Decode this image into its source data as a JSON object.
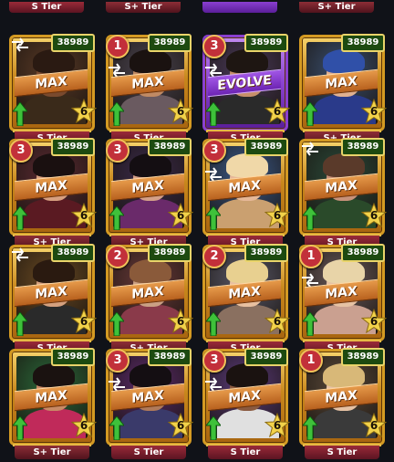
{
  "top_row_tiers": [
    "S Tier",
    "S+ Tier",
    "",
    "S+ Tier"
  ],
  "cards": [
    {
      "score": "38989",
      "level": "",
      "swap": true,
      "badge": "MAX",
      "stars": "6",
      "tier": "S Tier",
      "frame": "gold",
      "skin": "#7a4a2e",
      "hair": "#2a1a12",
      "outfit": "#3a2a1a",
      "bg": "#5a3a26"
    },
    {
      "score": "38989",
      "level": "1",
      "swap": true,
      "badge": "MAX",
      "stars": "6",
      "tier": "S Tier",
      "frame": "gold",
      "skin": "#c08a64",
      "hair": "#1a1210",
      "outfit": "#6a5a60",
      "bg": "#4a4450"
    },
    {
      "score": "38989",
      "level": "3",
      "swap": true,
      "badge": "EVOLVE",
      "stars": "6",
      "tier": "S Tier",
      "frame": "purple",
      "skin": "#c6906a",
      "hair": "#1e1612",
      "outfit": "#2a2a2a",
      "bg": "#4a3a5a"
    },
    {
      "score": "38989",
      "level": "",
      "swap": false,
      "badge": "MAX",
      "stars": "6",
      "tier": "S+ Tier",
      "frame": "gold",
      "skin": "#e0b090",
      "hair": "#3050a8",
      "outfit": "#2a3a8a",
      "bg": "#3a5070"
    },
    {
      "score": "38989",
      "level": "3",
      "swap": false,
      "badge": "MAX",
      "stars": "6",
      "tier": "S+ Tier",
      "frame": "gold",
      "skin": "#d8a080",
      "hair": "#1a1010",
      "outfit": "#5a1a22",
      "bg": "#5a2a32"
    },
    {
      "score": "38989",
      "level": "3",
      "swap": false,
      "badge": "MAX",
      "stars": "6",
      "tier": "S+ Tier",
      "frame": "gold",
      "skin": "#d4a088",
      "hair": "#140e12",
      "outfit": "#6a2a6a",
      "bg": "#3a2a4a"
    },
    {
      "score": "38989",
      "level": "3",
      "swap": true,
      "badge": "MAX",
      "stars": "6",
      "tier": "S Tier",
      "frame": "gold",
      "skin": "#e6b898",
      "hair": "#f0d8a8",
      "outfit": "#caa070",
      "bg": "#3a5a8a"
    },
    {
      "score": "38989",
      "level": "",
      "swap": true,
      "badge": "MAX",
      "stars": "6",
      "tier": "S Tier",
      "frame": "gold",
      "skin": "#c8927a",
      "hair": "#5a3a2a",
      "outfit": "#2a4a2a",
      "bg": "#2a4a3a"
    },
    {
      "score": "38989",
      "level": "",
      "swap": true,
      "badge": "MAX",
      "stars": "6",
      "tier": "S Tier",
      "frame": "gold",
      "skin": "#d4a07e",
      "hair": "#2a1a10",
      "outfit": "#2a2a2a",
      "bg": "#6a4a22"
    },
    {
      "score": "38989",
      "level": "2",
      "swap": false,
      "badge": "MAX",
      "stars": "6",
      "tier": "S+ Tier",
      "frame": "gold",
      "skin": "#caa084",
      "hair": "#8a5a3a",
      "outfit": "#8a3a4a",
      "bg": "#6a3a3a"
    },
    {
      "score": "38989",
      "level": "2",
      "swap": false,
      "badge": "MAX",
      "stars": "6",
      "tier": "S Tier",
      "frame": "gold",
      "skin": "#e8c0a0",
      "hair": "#e8d090",
      "outfit": "#8a7060",
      "bg": "#5a5a6a"
    },
    {
      "score": "38989",
      "level": "1",
      "swap": true,
      "badge": "MAX",
      "stars": "6",
      "tier": "S Tier",
      "frame": "gold",
      "skin": "#e6c2a4",
      "hair": "#e8d4a8",
      "outfit": "#caa090",
      "bg": "#6a5a5a"
    },
    {
      "score": "38989",
      "level": "",
      "swap": false,
      "badge": "MAX",
      "stars": "6",
      "tier": "S+ Tier",
      "frame": "gold",
      "skin": "#c88a66",
      "hair": "#1a1210",
      "outfit": "#c02a5a",
      "bg": "#2a6a3a"
    },
    {
      "score": "38989",
      "level": "3",
      "swap": true,
      "badge": "MAX",
      "stars": "6",
      "tier": "S Tier",
      "frame": "gold",
      "skin": "#b07a5a",
      "hair": "#140e12",
      "outfit": "#3a3a6a",
      "bg": "#5a2a6a"
    },
    {
      "score": "38989",
      "level": "3",
      "swap": true,
      "badge": "MAX",
      "stars": "6",
      "tier": "S Tier",
      "frame": "gold",
      "skin": "#8a5a40",
      "hair": "#1a1210",
      "outfit": "#e0e0e0",
      "bg": "#5a3a7a"
    },
    {
      "score": "38989",
      "level": "1",
      "swap": false,
      "badge": "MAX",
      "stars": "6",
      "tier": "S Tier",
      "frame": "gold",
      "skin": "#e6c2a4",
      "hair": "#d8b878",
      "outfit": "#3a3a3a",
      "bg": "#5a4a3a"
    }
  ]
}
